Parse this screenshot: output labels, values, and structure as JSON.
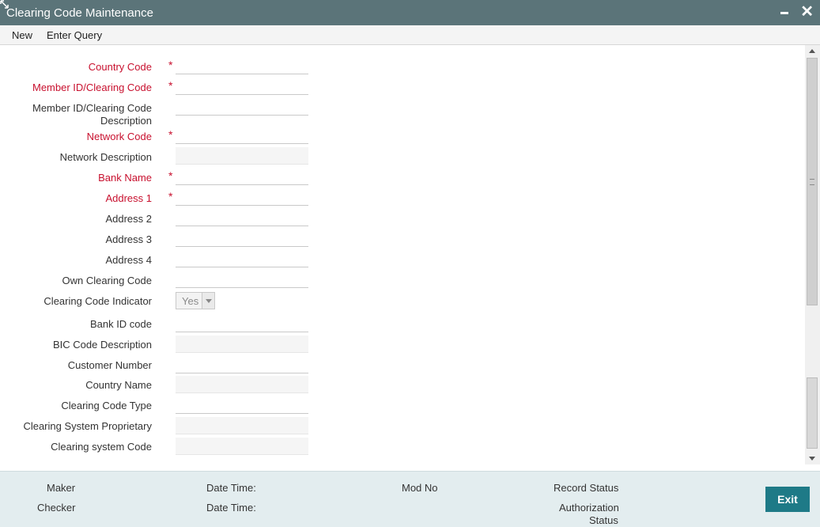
{
  "window": {
    "title": "Clearing Code Maintenance",
    "minimize_glyph": "–",
    "close_glyph": "✕"
  },
  "toolbar": {
    "new_label": "New",
    "enter_query_label": "Enter Query"
  },
  "form": {
    "country_code_label": "Country Code",
    "member_id_label": "Member ID/Clearing Code",
    "member_desc_label_line1": "Member ID/Clearing Code",
    "member_desc_label_line2": "Description",
    "network_code_label": "Network Code",
    "network_desc_label": "Network Description",
    "bank_name_label": "Bank Name",
    "address1_label": "Address 1",
    "address2_label": "Address 2",
    "address3_label": "Address 3",
    "address4_label": "Address 4",
    "own_clearing_code_label": "Own Clearing Code",
    "clearing_code_indicator_label": "Clearing Code Indicator",
    "clearing_code_indicator_value": "Yes",
    "bank_id_code_label": "Bank ID code",
    "bic_code_desc_label": "BIC Code Description",
    "customer_number_label": "Customer Number",
    "country_name_label": "Country Name",
    "clearing_code_type_label": "Clearing Code Type",
    "clearing_system_proprietary_label": "Clearing System Proprietary",
    "clearing_system_code_label": "Clearing system Code",
    "required_marker": "*"
  },
  "footer": {
    "maker_label": "Maker",
    "checker_label": "Checker",
    "date_time_label": "Date Time:",
    "mod_no_label": "Mod No",
    "record_status_label": "Record Status",
    "authorization_label_line1": "Authorization",
    "authorization_label_line2": "Status",
    "exit_label": "Exit"
  },
  "colors": {
    "titlebar": "#5b7479",
    "required": "#c8102e",
    "footer": "#e3edef",
    "exit_button": "#1e7a87"
  }
}
